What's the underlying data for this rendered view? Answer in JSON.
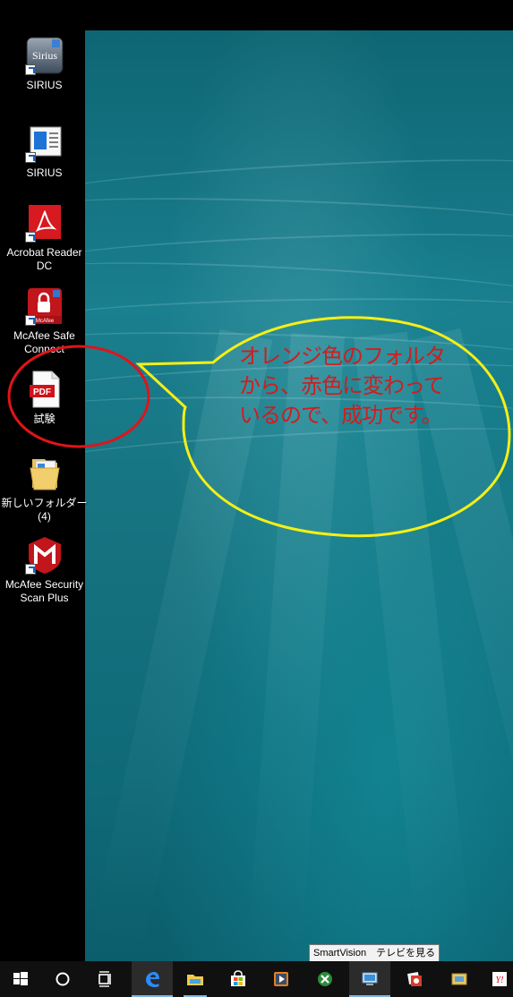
{
  "desktop": {
    "icons": [
      {
        "label": "SIRIUS",
        "icon": "sirius-app-icon"
      },
      {
        "label": "SIRIUS",
        "icon": "sirius-document-icon"
      },
      {
        "label": "Acrobat Reader DC",
        "icon": "acrobat-reader-icon"
      },
      {
        "label": "McAfee Safe Connect",
        "icon": "mcafee-safe-connect-icon"
      },
      {
        "label": "試験",
        "icon": "pdf-file-icon",
        "badge": "PDF"
      },
      {
        "label": "新しいフォルダー (4)",
        "icon": "folder-icon"
      },
      {
        "label": "McAfee Security Scan Plus",
        "icon": "mcafee-security-scan-icon"
      }
    ]
  },
  "annotation": {
    "lines": [
      "オレンジ色のフォルタ",
      "から、赤色に変わって",
      "いるので、成功です。"
    ],
    "text_color": "#d11d1d",
    "bubble_color": "#f5ef16",
    "circle_color": "#e0141a"
  },
  "tooltip": {
    "text": "SmartVision　テレビを見る"
  },
  "taskbar": {
    "buttons": [
      {
        "icon": "windows-start-icon"
      },
      {
        "icon": "cortana-search-icon"
      },
      {
        "icon": "task-view-icon"
      },
      {
        "icon": "edge-browser-icon",
        "active": true
      },
      {
        "icon": "file-explorer-icon",
        "open": true
      },
      {
        "icon": "store-icon"
      },
      {
        "icon": "media-player-icon"
      },
      {
        "icon": "excel-like-app-icon"
      },
      {
        "icon": "smartvision-icon",
        "hover": true
      },
      {
        "icon": "photo-app-icon"
      },
      {
        "icon": "card-app-icon"
      },
      {
        "icon": "yahoo-icon"
      }
    ]
  }
}
